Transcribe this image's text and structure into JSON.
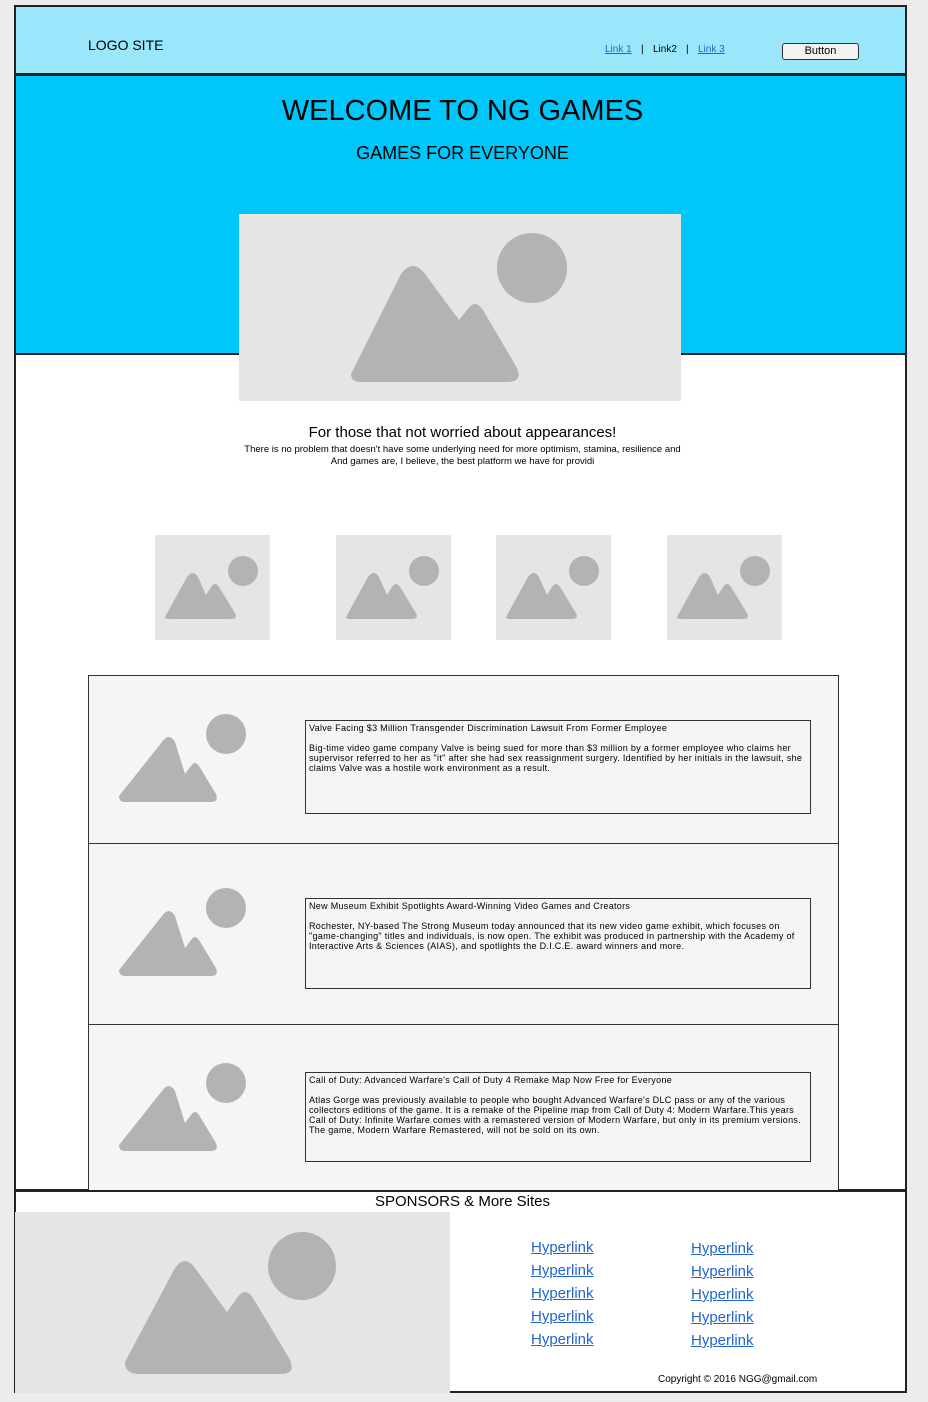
{
  "header": {
    "logo": "LOGO SITE",
    "nav": [
      {
        "label": "Link 1",
        "linked": true
      },
      {
        "label": "Link2",
        "linked": false
      },
      {
        "label": "Link 3",
        "linked": true
      }
    ],
    "separator": "|",
    "button_label": "Button"
  },
  "hero": {
    "title": "WELCOME TO NG GAMES",
    "subtitle": "GAMES FOR EVERYONE"
  },
  "intro": {
    "heading": "For those that not worried about appearances!",
    "line1": "There is no problem that doesn't have some underlying need for more optimism, stamina, resilience and",
    "line2": "And games are, I believe, the best platform we have for providi"
  },
  "news": [
    {
      "title": "Valve Facing $3 Million Transgender Discrimination Lawsuit From Former Employee",
      "body": "Big-time video game company Valve is being sued for more than $3 million by a former employee who claims her supervisor referred to her as \"it\" after she had sex reassignment surgery. Identified by her initials in the lawsuit, she claims Valve was a hostile work environment as a result."
    },
    {
      "title": "New Museum Exhibit Spotlights Award-Winning Video Games and Creators",
      "body": "Rochester, NY-based The Strong Museum today announced that its new video game exhibit, which focuses on \"game-changing\" titles and individuals, is now open. The exhibit was produced in partnership with the Academy of Interactive Arts & Sciences (AIAS), and spotlights the D.I.C.E. award winners and more."
    },
    {
      "title": "Call of Duty: Advanced Warfare's Call of Duty 4 Remake Map Now Free for Everyone",
      "body": "Atlas Gorge was previously available to people who bought Advanced Warfare's DLC pass or any of the various collectors editions of the game. It is a remake of the Pipeline map from Call of Duty 4: Modern Warfare.This years Call of Duty: Infinite Warfare comes with a remastered version of Modern Warfare, but only in its premium versions. The game, Modern Warfare Remastered, will not be sold on its own."
    }
  ],
  "footer": {
    "title": "SPONSORS & More Sites",
    "links_col1": [
      "Hyperlink",
      "Hyperlink",
      "Hyperlink",
      "Hyperlink",
      "Hyperlink"
    ],
    "links_col2": [
      "Hyperlink",
      "Hyperlink",
      "Hyperlink",
      "Hyperlink",
      "Hyperlink"
    ],
    "copyright": "Copyright © 2016 NGG@gmail.com"
  }
}
